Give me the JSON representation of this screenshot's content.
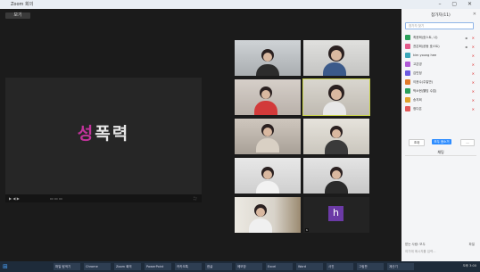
{
  "window": {
    "title": "Zoom 회의"
  },
  "main": {
    "view_button": "보기"
  },
  "share": {
    "word1": "성",
    "word2": "폭력"
  },
  "panel": {
    "title": "참가자(11)",
    "search_placeholder": "참가자 찾기",
    "participants": [
      {
        "name": "최윤희(호스트, 나)",
        "color": "#2aa05a"
      },
      {
        "name": "권은희(공동 호스트)",
        "color": "#e35a8a"
      },
      {
        "name": "kim young hee",
        "color": "#3aa6b8"
      },
      {
        "name": "고은영",
        "color": "#b05ad6"
      },
      {
        "name": "김민정",
        "color": "#6a5ae0"
      },
      {
        "name": "이윤수(주말반)",
        "color": "#e07a2a"
      },
      {
        "name": "박소현(웰빙 수업)",
        "color": "#2aa05a"
      },
      {
        "name": "송지희",
        "color": "#e0a22a"
      },
      {
        "name": "정다은",
        "color": "#e35a5a"
      }
    ],
    "buttons": {
      "invite": "초대",
      "mute_all": "모두 음소거",
      "more": "..."
    },
    "chat_label": "채팅",
    "chat_to": "받는 사람: 모두",
    "chat_file": "파일",
    "chat_input_placeholder": "여기에 메시지를 입력..."
  },
  "tiles": [
    {
      "name": ""
    },
    {
      "name": ""
    },
    {
      "name": ""
    },
    {
      "name": ""
    },
    {
      "name": ""
    },
    {
      "name": ""
    },
    {
      "name": ""
    },
    {
      "name": ""
    },
    {
      "name": ""
    },
    {
      "name": "h",
      "avatar": "h"
    }
  ],
  "taskbar": {
    "apps": [
      "파일 탐색기",
      "Chrome",
      "Zoom 회의",
      "PowerPoint",
      "카카오톡",
      "한글",
      "메모장",
      "Excel",
      "Word",
      "사진",
      "그림판",
      "계산기"
    ],
    "clock": "오후 3:00"
  }
}
